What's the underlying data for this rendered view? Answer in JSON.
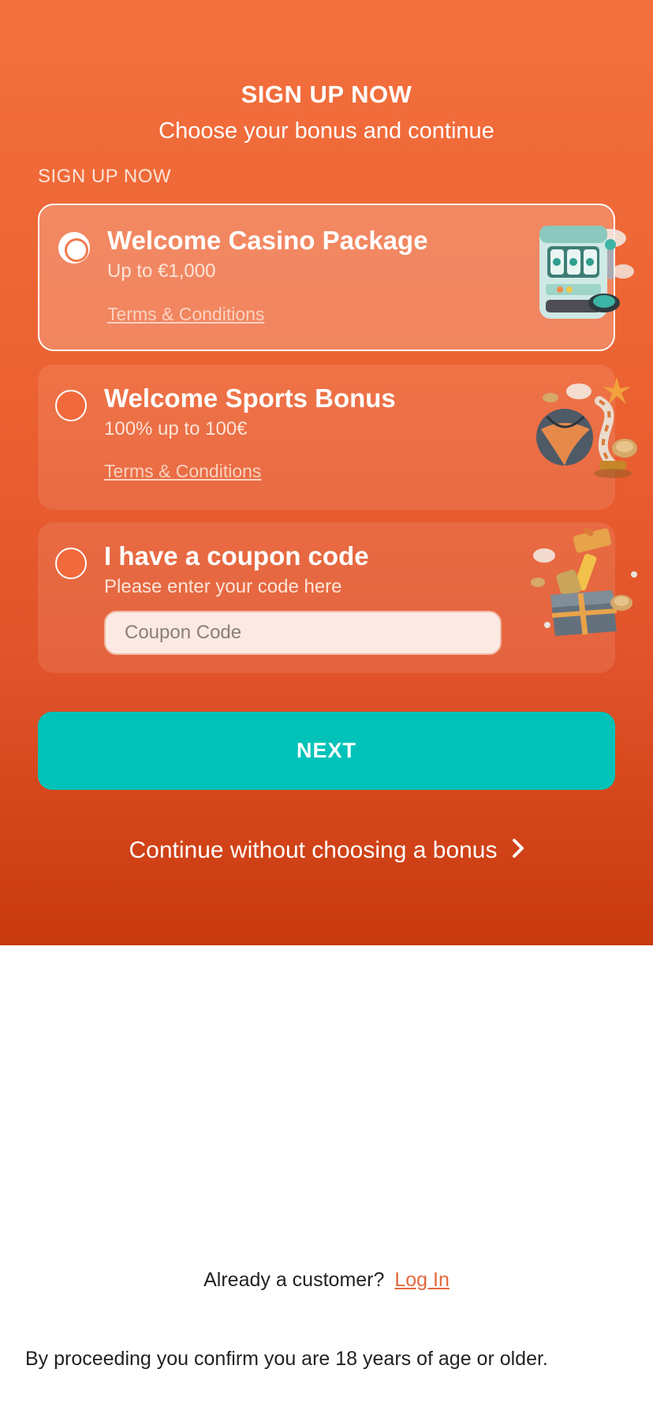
{
  "colors": {
    "accent": "#f26a3c",
    "next_button": "#00c2b8",
    "link": "#e3683d"
  },
  "header": {
    "title": "SIGN UP NOW",
    "subtitle": "Choose your bonus and continue"
  },
  "section_label": "SIGN UP NOW",
  "bonuses": [
    {
      "title": "Welcome Casino Package",
      "subtitle": "Up to €1,000",
      "terms": "Terms & Conditions",
      "selected": true,
      "icon": "slot-machine-icon"
    },
    {
      "title": "Welcome Sports Bonus",
      "subtitle": "100% up to 100€",
      "terms": "Terms & Conditions",
      "selected": false,
      "icon": "sports-ball-icon"
    },
    {
      "title": "I have a coupon code",
      "subtitle": "Please enter your code here",
      "input_placeholder": "Coupon Code",
      "input_value": "",
      "selected": false,
      "icon": "gift-box-icon"
    }
  ],
  "actions": {
    "next_label": "NEXT",
    "continue_label": "Continue without choosing a bonus"
  },
  "footer": {
    "customer_prompt": "Already a customer?",
    "login_label": "Log In",
    "age_note": "By proceeding you confirm you are 18 years of age or older."
  }
}
